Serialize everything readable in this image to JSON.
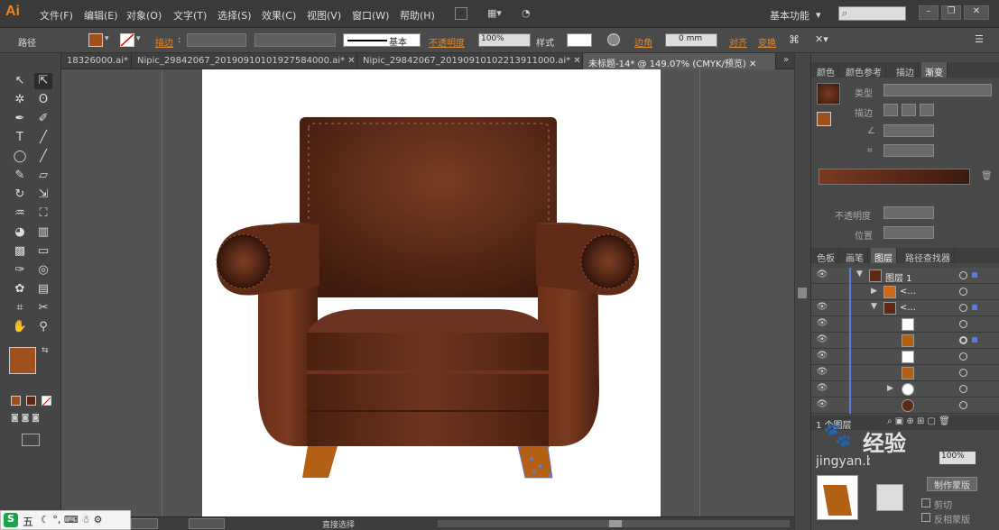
{
  "app": {
    "logo": "Ai"
  },
  "menu": [
    "文件(F)",
    "编辑(E)",
    "对象(O)",
    "文字(T)",
    "选择(S)",
    "效果(C)",
    "视图(V)",
    "窗口(W)",
    "帮助(H)"
  ],
  "workspace": {
    "label": "基本功能",
    "search_placeholder": ""
  },
  "control": {
    "selection": "路径",
    "stroke_label": "描边",
    "stroke_profile": "基本",
    "opacity_label": "不透明度",
    "opacity_value": "100%",
    "style_label": "样式",
    "corner_label": "边角",
    "corner_value": "0 mm",
    "align_label": "对齐",
    "transform_label": "变换",
    "fill_color": "#a0501a"
  },
  "tabs": [
    {
      "label": "18326000.ai*",
      "active": false
    },
    {
      "label": "Nipic_29842067_20190910101927584000.ai*",
      "active": false
    },
    {
      "label": "Nipic_29842067_20190910102213911000.ai*",
      "active": false
    },
    {
      "label": "未标题-14* @ 149.07% (CMYK/预览)",
      "active": true
    }
  ],
  "panel_top": {
    "tabs": [
      "颜色",
      "颜色参考",
      "描边",
      "渐变"
    ],
    "type_label": "类型",
    "stroke_label": "描边",
    "opacity_label": "不透明度",
    "position_label": "位置",
    "gradient_start": "#7a3a22",
    "gradient_end": "#3a1a0d"
  },
  "panel_layers": {
    "tabs": [
      "色板",
      "画笔",
      "图层",
      "路径查找器"
    ],
    "layer_name": "图层 1",
    "sublayers": [
      "<...",
      "<..."
    ],
    "count": "1 个图层"
  },
  "panel_bottom": {
    "opacity_value": "100%",
    "make_mask": "制作蒙版",
    "clip": "剪切",
    "invert": "反相蒙版"
  },
  "status": {
    "tool": "直接选择"
  },
  "watermark": {
    "brand": "经验",
    "site": "jingyan.baidu.com"
  },
  "ime": {
    "label": "五"
  },
  "colors": {
    "fill": "#a0501a",
    "accent": "#e08a2e"
  }
}
